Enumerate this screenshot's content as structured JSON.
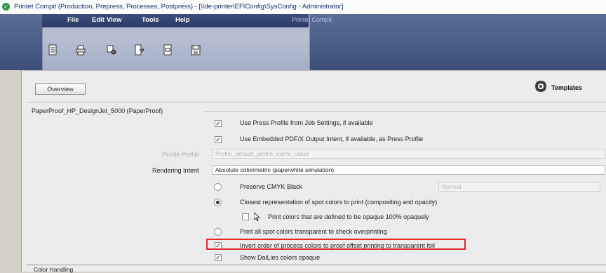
{
  "window": {
    "title": "Printet Compit (Production, Prepress, Processes, Postpress) - [\\Ide-printer\\EFIConfig\\SysConfig - Administrator]"
  },
  "menu": {
    "items": [
      "File",
      "Edit",
      "View",
      "Tools",
      "Help"
    ],
    "right_label": "Printet Compit"
  },
  "toolbar": {
    "icons": [
      "document-icon",
      "printer-icon",
      "settings-icon",
      "export-icon",
      "page-icon",
      "save-icon"
    ]
  },
  "header": {
    "overview_label": "Overview",
    "templates_label": "Templates"
  },
  "section": {
    "title": "PaperProof_HP_DesignJet_5000 (PaperProof)"
  },
  "settings": {
    "use_press_profile": {
      "label": "Use Press Profile from Job Settings, if available",
      "checked": true
    },
    "use_embedded_pdfx": {
      "label": "Use Embedded PDF/X Output Intent, if available, as Press Profile",
      "checked": true
    },
    "profile_name": {
      "label": "Profile Profile",
      "value": "Profile_default_profile_name_value"
    },
    "rendering_intent": {
      "label": "Rendering Intent",
      "value": "Absolute colorimetric (paperwhite simulation)"
    },
    "preserve_cmyk_black": {
      "label": "Preserve CMYK Black",
      "selected": false,
      "option_value": "Normal"
    },
    "closest_representation": {
      "label": "Closest representation of spot colors to print (compositing and opacity)",
      "selected": true
    },
    "print_opaque": {
      "label": "Print colors that are defined to be opaque 100% opaquely",
      "checked": false
    },
    "print_all_transparent": {
      "label": "Print all spot colors transparent to check overprinting",
      "selected": false
    },
    "invert_order": {
      "label": "Invert order of process colors to proof offset printing to transparent foil",
      "checked": true
    },
    "show_dailies": {
      "label": "Show DaiLies colors opaque",
      "checked": true
    }
  },
  "footer_section": {
    "title": "Color Handling"
  }
}
